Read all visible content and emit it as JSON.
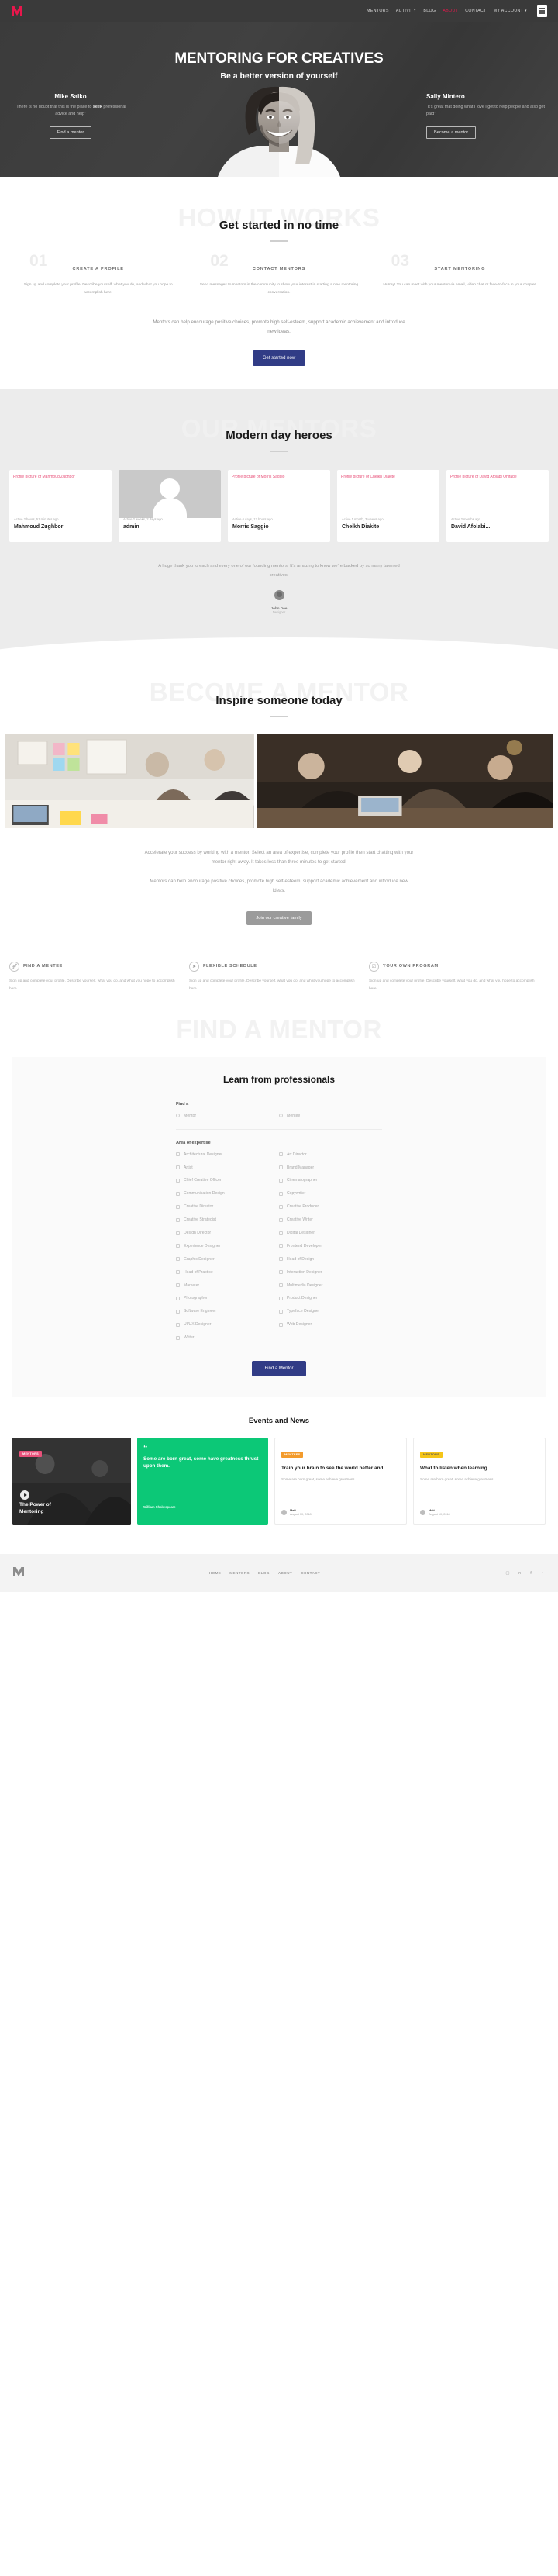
{
  "nav": {
    "brand_icon": "m-logo-icon",
    "links": [
      {
        "label": "MENTORS",
        "active": false
      },
      {
        "label": "ACTIVITY",
        "active": false
      },
      {
        "label": "BLOG",
        "active": false
      },
      {
        "label": "ABOUT",
        "active": true
      },
      {
        "label": "CONTACT",
        "active": false
      },
      {
        "label": "MY ACCOUNT ▾",
        "active": false
      }
    ],
    "menu_icon": "hamburger-icon",
    "accent_color": "#e8174c",
    "background": "#3a3a3a"
  },
  "hero": {
    "title": "MENTORING FOR CREATIVES",
    "subtitle": "Be a better version of yourself",
    "left": {
      "name": "Mike Saiko",
      "quote_before": "“There is no doubt that this is the place to ",
      "quote_bold": "seek",
      "quote_after": " professional advice and help”",
      "button": "Find a mentor"
    },
    "right": {
      "name": "Sally Mintero",
      "quote_before": "“It’s great that doing what I love I get to help people and also get paid”",
      "quote_bold": "",
      "quote_after": "",
      "button": "Become a mentor"
    }
  },
  "how_it_works": {
    "ghost": "HOW IT WORKS",
    "title": "Get started in no time",
    "steps": [
      {
        "number": "01",
        "label": "CREATE A PROFILE",
        "desc": "Sign up and complete your profile. Describe yourself, what you do, and what you hope to accomplish here."
      },
      {
        "number": "02",
        "label": "CONTACT MENTORS",
        "desc": "Send messages to mentors in the community to show your interest in starting a new mentoring conversation."
      },
      {
        "number": "03",
        "label": "START MENTORING",
        "desc": "Hurray! You can meet with your mentor via email, video chat or face-to-face in your chapter."
      }
    ],
    "paragraph": "Mentors can help encourage positive choices, promote high self-esteem, support academic achievement and introduce new ideas.",
    "button": "Get started now",
    "button_color": "#313c86"
  },
  "our_mentors": {
    "ghost": "OUR MENTORS",
    "title": "Modern day heroes",
    "cards": [
      {
        "alt": "Profile picture of Mahmoud Zughbor",
        "active": "Active 2 hours, 51 minutes ago",
        "name": "Mahmoud Zughbor",
        "has_image": false
      },
      {
        "alt": "",
        "active": "Active 2 weeks, 2 days ago",
        "name": "admin",
        "has_image": true
      },
      {
        "alt": "Profile picture of Morris Saggio",
        "active": "Active 6 days, 13 hours ago",
        "name": "Morris Saggio",
        "has_image": false
      },
      {
        "alt": "Profile picture of Cheikh Diakite",
        "active": "Active 1 month, 3 weeks ago",
        "name": "Cheikh Diakite",
        "has_image": false
      },
      {
        "alt": "Profile picture of David Afolabi Onifade",
        "active": "Active 2 months ago",
        "name": "David Afolabi...",
        "has_image": false
      }
    ],
    "thanks": "A huge thank you to each and every one of our founding mentors. It’s amazing to know we’re backed by so many talented creatives.",
    "founder_name": "John Doe",
    "founder_role": "Designer"
  },
  "become_mentor": {
    "ghost": "BECOME A MENTOR",
    "title": "Inspire someone today",
    "paragraph1": "Accelerate your success by working with a mentor. Select an area of expertise, complete your profile then start chatting with your mentor right away. It takes less than three minutes to get started.",
    "paragraph2": "Mentors can help encourage positive choices, promote high self-esteem, support academic achievement and introduce new ideas.",
    "button": "Join our creative family",
    "features": [
      {
        "icon": "users-icon",
        "glyph": "⚤",
        "title": "FIND A MENTEE",
        "desc": "Sign up and complete your profile. Describe yourself, what you do, and what you hope to accomplish here."
      },
      {
        "icon": "paper-plane-icon",
        "glyph": "➤",
        "title": "FLEXIBLE SCHEDULE",
        "desc": "Sign up and complete your profile. Describe yourself, what you do, and what you hope to accomplish here."
      },
      {
        "icon": "clipboard-check-icon",
        "glyph": "☑",
        "title": "YOUR OWN PROGRAM",
        "desc": "Sign up and complete your profile. Describe yourself, what you do, and what you hope to accomplish here."
      }
    ]
  },
  "find_mentor": {
    "ghost": "FIND A MENTOR",
    "title": "Learn from professionals",
    "find_a_label": "Find a",
    "find_a_options": [
      "Mentor",
      "Mentee"
    ],
    "expertise_label": "Area of expertise",
    "expertise_options": [
      "Architectural Designer",
      "Art Director",
      "Artist",
      "Brand Manager",
      "Chief Creative Officer",
      "Cinematographer",
      "Communication Design",
      "Copywriter",
      "Creative Director",
      "Creative Producer",
      "Creative Strategist",
      "Creative Writer",
      "Design Director",
      "Digital Designer",
      "Experience Designer",
      "Frontend Developer",
      "Graphic Designer",
      "Head of Design",
      "Head of Practice",
      "Interaction Designer",
      "Marketer",
      "Multimedia Designer",
      "Photographer",
      "Product Designer",
      "Software Engineer",
      "Typeface Designer",
      "UI/UX Designer",
      "Web Designer",
      "Writer",
      ""
    ],
    "submit": "Find a Mentor",
    "submit_color": "#313c86"
  },
  "events": {
    "title": "Events and News",
    "cards": [
      {
        "kind": "video",
        "tag": "MENTORS",
        "tag_color": "pink",
        "title": "The Power of Mentoring",
        "author": "",
        "date": "",
        "desc": ""
      },
      {
        "kind": "quote",
        "tag": "",
        "tag_color": "green",
        "quote": "Some are born great, some have greatness thrust upon them.",
        "author": "William Shakespeare",
        "date": "",
        "desc": ""
      },
      {
        "kind": "article",
        "tag": "MENTEES",
        "tag_color": "orange",
        "title": "Train your brain to see the world better and...",
        "desc": "Some are born great, some achieve greatness...",
        "author": "Matt",
        "date": "August 10, 2018"
      },
      {
        "kind": "article",
        "tag": "MENTORS",
        "tag_color": "yellow",
        "title": "What to listen when learning",
        "desc": "Some are born great, some achieve greatness...",
        "author": "Matt",
        "date": "August 10, 2018"
      }
    ]
  },
  "footer": {
    "brand_icon": "m-logo-icon",
    "links": [
      "HOME",
      "MENTORS",
      "BLOG",
      "ABOUT",
      "CONTACT"
    ],
    "socials": [
      {
        "name": "instagram-icon",
        "glyph": "▢"
      },
      {
        "name": "linkedin-icon",
        "glyph": "in"
      },
      {
        "name": "facebook-icon",
        "glyph": "f"
      },
      {
        "name": "twitter-icon",
        "glyph": "ᵕ"
      }
    ]
  }
}
